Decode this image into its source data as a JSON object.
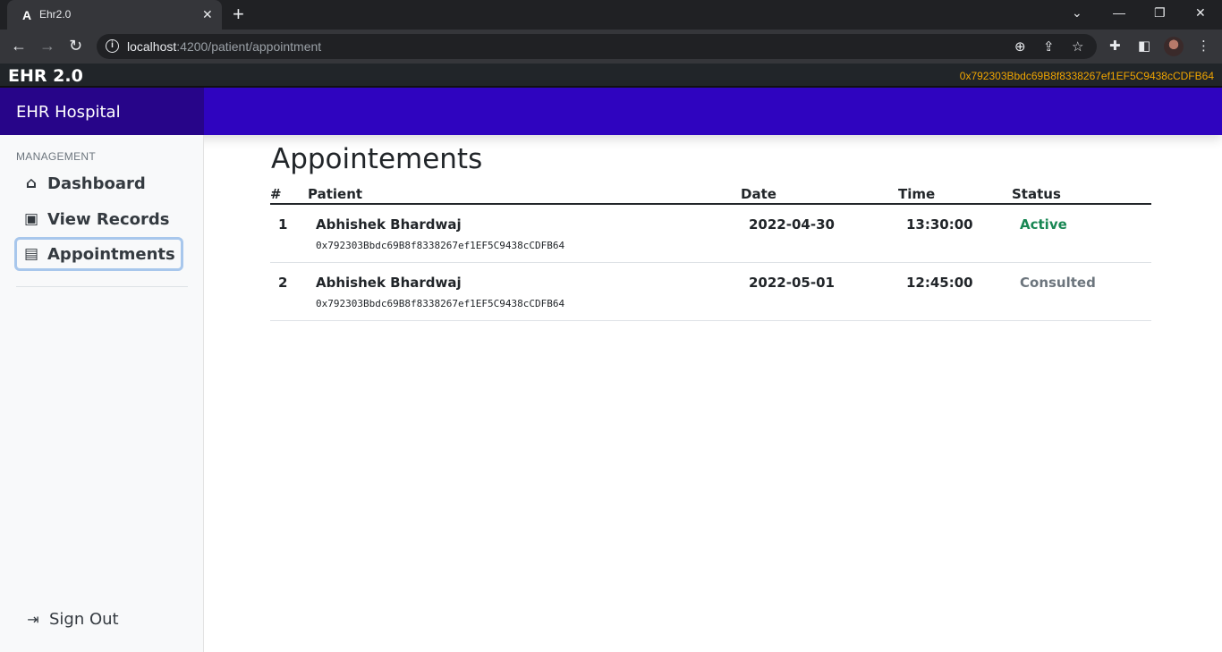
{
  "browser": {
    "tab_title": "Ehr2.0",
    "tab_favicon": "A",
    "url_host": "localhost",
    "url_path": ":4200/patient/appointment"
  },
  "appbar": {
    "brand": "EHR 2.0",
    "wallet_address": "0x792303Bbdc69B8f8338267ef1EF5C9438cCDFB64"
  },
  "header": {
    "hospital_name": "EHR Hospital"
  },
  "sidebar": {
    "section_label": "MANAGEMENT",
    "items": [
      {
        "label": "Dashboard",
        "icon": "home-icon"
      },
      {
        "label": "View Records",
        "icon": "medical-file-icon"
      },
      {
        "label": "Appointments",
        "icon": "clipboard-icon"
      }
    ],
    "signout_label": "Sign Out"
  },
  "main": {
    "title": "Appointements",
    "columns": [
      "#",
      "Patient",
      "Date",
      "Time",
      "Status"
    ],
    "rows": [
      {
        "num": "1",
        "patient": "Abhishek Bhardwaj",
        "address": "0x792303Bbdc69B8f8338267ef1EF5C9438cCDFB64",
        "date": "2022-04-30",
        "time": "13:30:00",
        "status": "Active"
      },
      {
        "num": "2",
        "patient": "Abhishek Bhardwaj",
        "address": "0x792303Bbdc69B8f8338267ef1EF5C9438cCDFB64",
        "date": "2022-05-01",
        "time": "12:45:00",
        "status": "Consulted"
      }
    ]
  },
  "colors": {
    "header_purple": "#2f04bf",
    "brand_purple": "#270589",
    "wallet_orange": "#f0a500",
    "status_active": "#198754",
    "status_consulted": "#6c757d"
  }
}
